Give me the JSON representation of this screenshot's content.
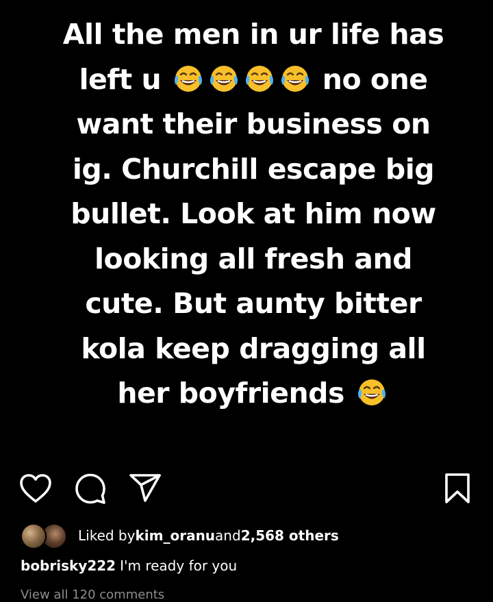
{
  "story": {
    "lines": [
      {
        "before": "All the men in ur life has",
        "emoji_count": 0,
        "after": ""
      },
      {
        "before": "left u",
        "emoji_count": 4,
        "after": "no one"
      },
      {
        "before": "want their business on",
        "emoji_count": 0,
        "after": ""
      },
      {
        "before": "ig. Churchill escape big",
        "emoji_count": 0,
        "after": ""
      },
      {
        "before": "bullet. Look at him now",
        "emoji_count": 0,
        "after": ""
      },
      {
        "before": "looking all fresh and",
        "emoji_count": 0,
        "after": ""
      },
      {
        "before": "cute. But aunty bitter",
        "emoji_count": 0,
        "after": ""
      },
      {
        "before": "kola keep dragging all",
        "emoji_count": 0,
        "after": ""
      },
      {
        "before": "her boyfriends",
        "emoji_count": 1,
        "after": ""
      }
    ],
    "emoji_icon": "face-with-tears-of-joy-icon"
  },
  "actions": {
    "like_icon": "heart-icon",
    "comment_icon": "comment-bubble-icon",
    "share_icon": "paper-plane-icon",
    "save_icon": "bookmark-icon"
  },
  "likes": {
    "prefix": "Liked by ",
    "user": "kim_oranu",
    "middle": " and ",
    "count": "2,568 others"
  },
  "caption": {
    "username": "bobrisky222",
    "text": "I'm ready for you"
  },
  "comments": {
    "view_all": "View all 120 comments"
  },
  "colors": {
    "background": "#000000",
    "text": "#ffffff",
    "muted": "#8e8e8e",
    "emoji_face": "#f7c02a"
  }
}
